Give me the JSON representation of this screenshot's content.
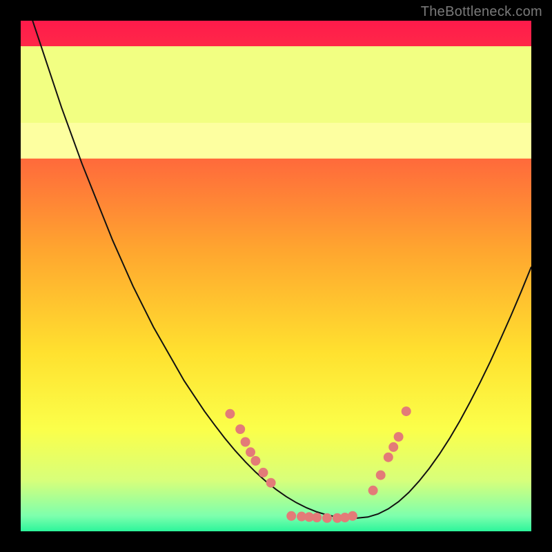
{
  "watermark": "TheBottleneck.com",
  "chart_data": {
    "type": "line",
    "title": "",
    "xlabel": "",
    "ylabel": "",
    "xlim": [
      0,
      100
    ],
    "ylim": [
      0,
      100
    ],
    "grid": false,
    "legend": false,
    "background_gradient": {
      "stops": [
        {
          "pos": 0.0,
          "color": "#ff1a4b"
        },
        {
          "pos": 0.2,
          "color": "#ff5240"
        },
        {
          "pos": 0.45,
          "color": "#ffa62f"
        },
        {
          "pos": 0.65,
          "color": "#ffe12f"
        },
        {
          "pos": 0.8,
          "color": "#fbff4a"
        },
        {
          "pos": 0.9,
          "color": "#d8ff7a"
        },
        {
          "pos": 0.97,
          "color": "#7dffad"
        },
        {
          "pos": 1.0,
          "color": "#2cf59b"
        }
      ]
    },
    "bottom_bands": [
      {
        "y_from": 73,
        "y_to": 80,
        "color": "#fdffa0"
      },
      {
        "y_from": 80,
        "y_to": 95,
        "color": "#f2ff82"
      }
    ],
    "series": [
      {
        "name": "bottleneck-curve",
        "color": "#111111",
        "stroke_width": 2,
        "x": [
          0,
          2,
          4,
          6,
          8,
          10,
          12,
          14,
          16,
          18,
          20,
          22,
          24,
          26,
          28,
          30,
          32,
          34,
          36,
          38,
          40,
          42,
          44,
          46,
          48,
          50,
          52,
          54,
          56,
          58,
          60,
          62,
          64,
          66,
          68,
          70,
          72,
          74,
          76,
          78,
          80,
          82,
          84,
          86,
          88,
          90,
          92,
          94,
          96,
          98,
          100
        ],
        "y": [
          107,
          101,
          95,
          89,
          83,
          77.5,
          72,
          67,
          62,
          57,
          52.5,
          48,
          44,
          40,
          36.5,
          33,
          29.5,
          26.5,
          23.5,
          20.8,
          18.2,
          15.8,
          13.6,
          11.6,
          9.8,
          8.2,
          6.8,
          5.6,
          4.6,
          3.8,
          3.2,
          2.8,
          2.6,
          2.6,
          2.8,
          3.4,
          4.4,
          5.8,
          7.6,
          9.8,
          12.3,
          15.1,
          18.2,
          21.6,
          25.3,
          29.2,
          33.3,
          37.7,
          42.2,
          46.9,
          51.8
        ]
      }
    ],
    "scatter": {
      "name": "sample-points",
      "color": "#e37b78",
      "radius": 7,
      "points": [
        {
          "x": 41,
          "y": 23
        },
        {
          "x": 43,
          "y": 20
        },
        {
          "x": 44,
          "y": 17.5
        },
        {
          "x": 45,
          "y": 15.5
        },
        {
          "x": 46,
          "y": 13.8
        },
        {
          "x": 47.5,
          "y": 11.5
        },
        {
          "x": 49,
          "y": 9.5
        },
        {
          "x": 53,
          "y": 3.0
        },
        {
          "x": 55,
          "y": 2.9
        },
        {
          "x": 56.5,
          "y": 2.8
        },
        {
          "x": 58,
          "y": 2.7
        },
        {
          "x": 60,
          "y": 2.6
        },
        {
          "x": 62,
          "y": 2.6
        },
        {
          "x": 63.5,
          "y": 2.7
        },
        {
          "x": 65,
          "y": 3.0
        },
        {
          "x": 69,
          "y": 8.0
        },
        {
          "x": 70.5,
          "y": 11.0
        },
        {
          "x": 72,
          "y": 14.5
        },
        {
          "x": 73,
          "y": 16.5
        },
        {
          "x": 74,
          "y": 18.5
        },
        {
          "x": 75.5,
          "y": 23.5
        }
      ]
    }
  }
}
